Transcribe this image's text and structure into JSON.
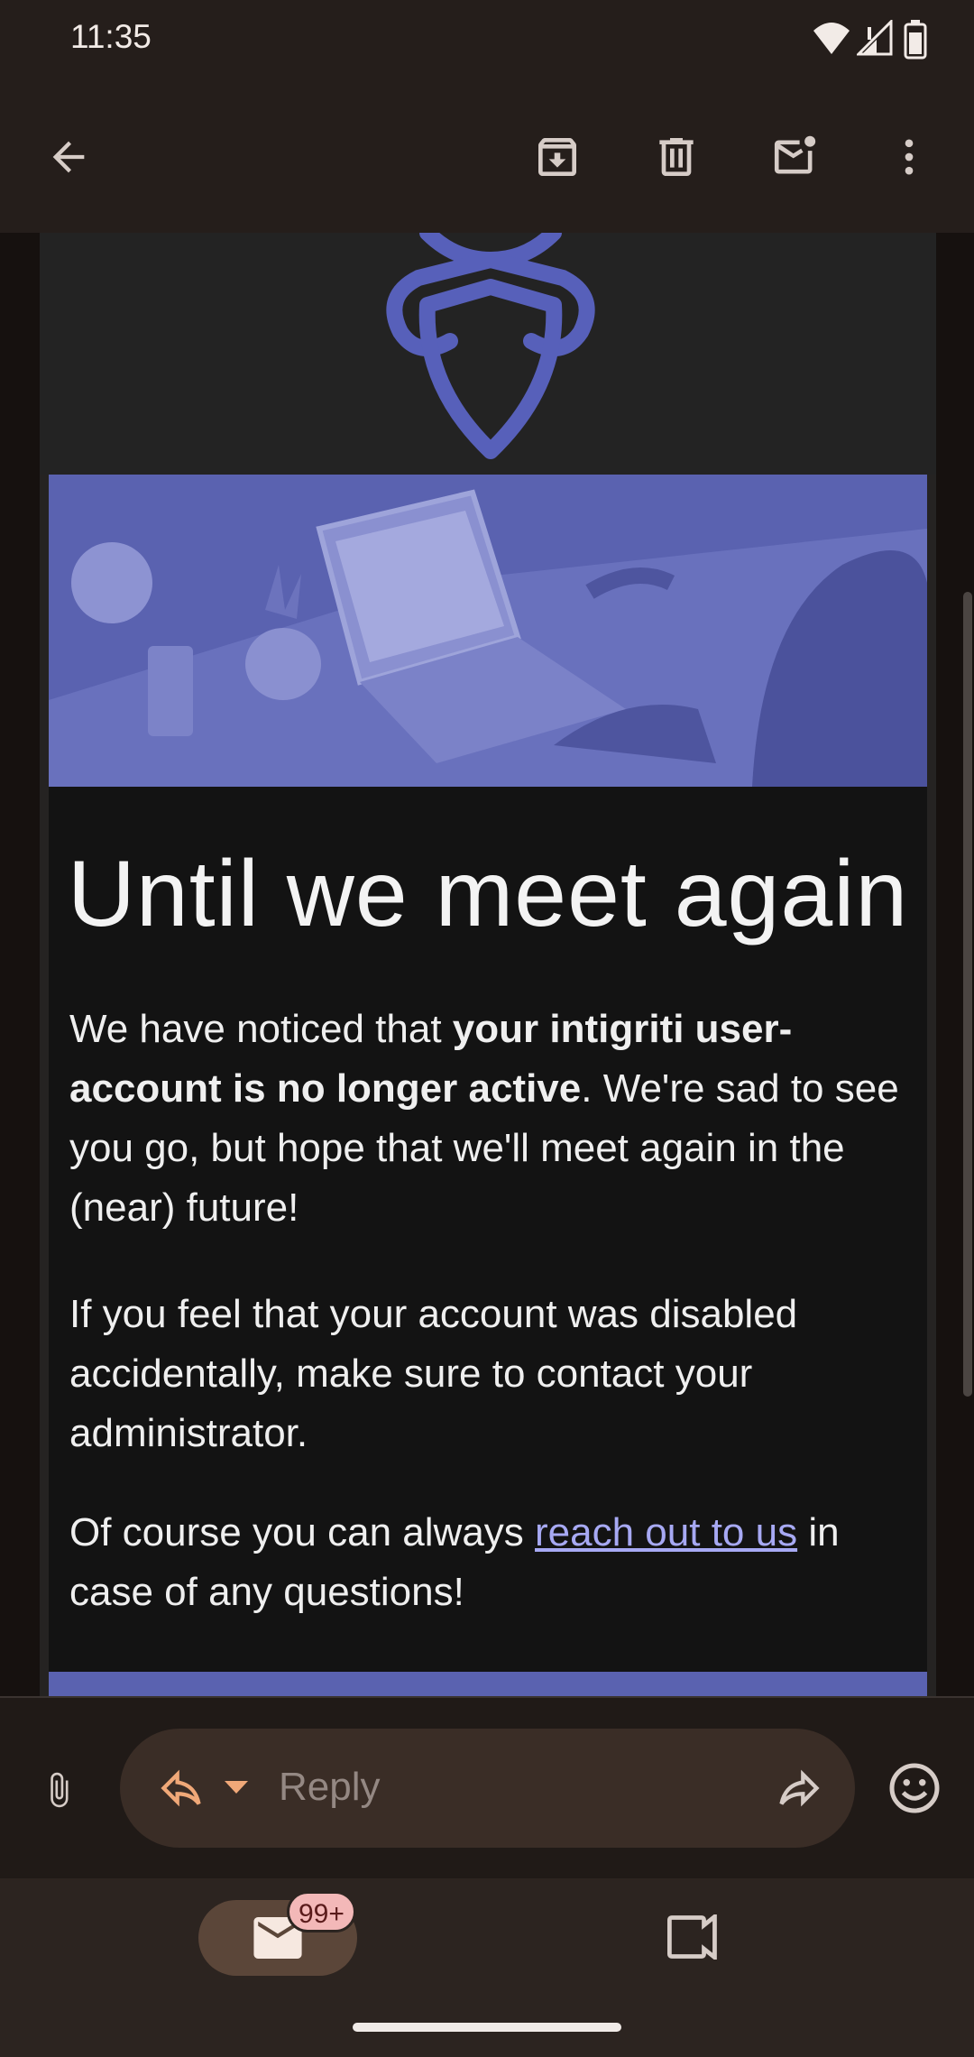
{
  "status_bar": {
    "time": "11:35",
    "icons": [
      "wifi-icon",
      "signal-icon",
      "battery-icon"
    ]
  },
  "app_bar": {
    "icons": [
      "back-arrow-icon",
      "archive-icon",
      "delete-icon",
      "mark-unread-icon",
      "more-vert-icon"
    ]
  },
  "email": {
    "logo_icon": "intigriti-bee-logo",
    "title": "Until we meet again",
    "p1_a": "We have noticed that ",
    "p1_bold": "your intigriti user-account is no longer active",
    "p1_b": ". We're sad to see you go, but hope that we'll meet again in the (near) future!",
    "p2": "If you feel that your account was disabled accidentally, make sure to contact your administrator.",
    "p3_a": "Of course you can always ",
    "p3_link": "reach out to us",
    "p3_b": " in case of any questions!"
  },
  "reply_bar": {
    "placeholder": "Reply",
    "icons": [
      "attachment-icon",
      "reply-icon",
      "dropdown-icon",
      "forward-icon",
      "emoji-icon"
    ]
  },
  "bottom_nav": {
    "mail_badge": "99+",
    "icons": [
      "mail-icon",
      "video-icon"
    ]
  },
  "colors": {
    "accent": "#5a62b0",
    "link": "#a7a9f3",
    "badge": "#f3b8b8"
  }
}
